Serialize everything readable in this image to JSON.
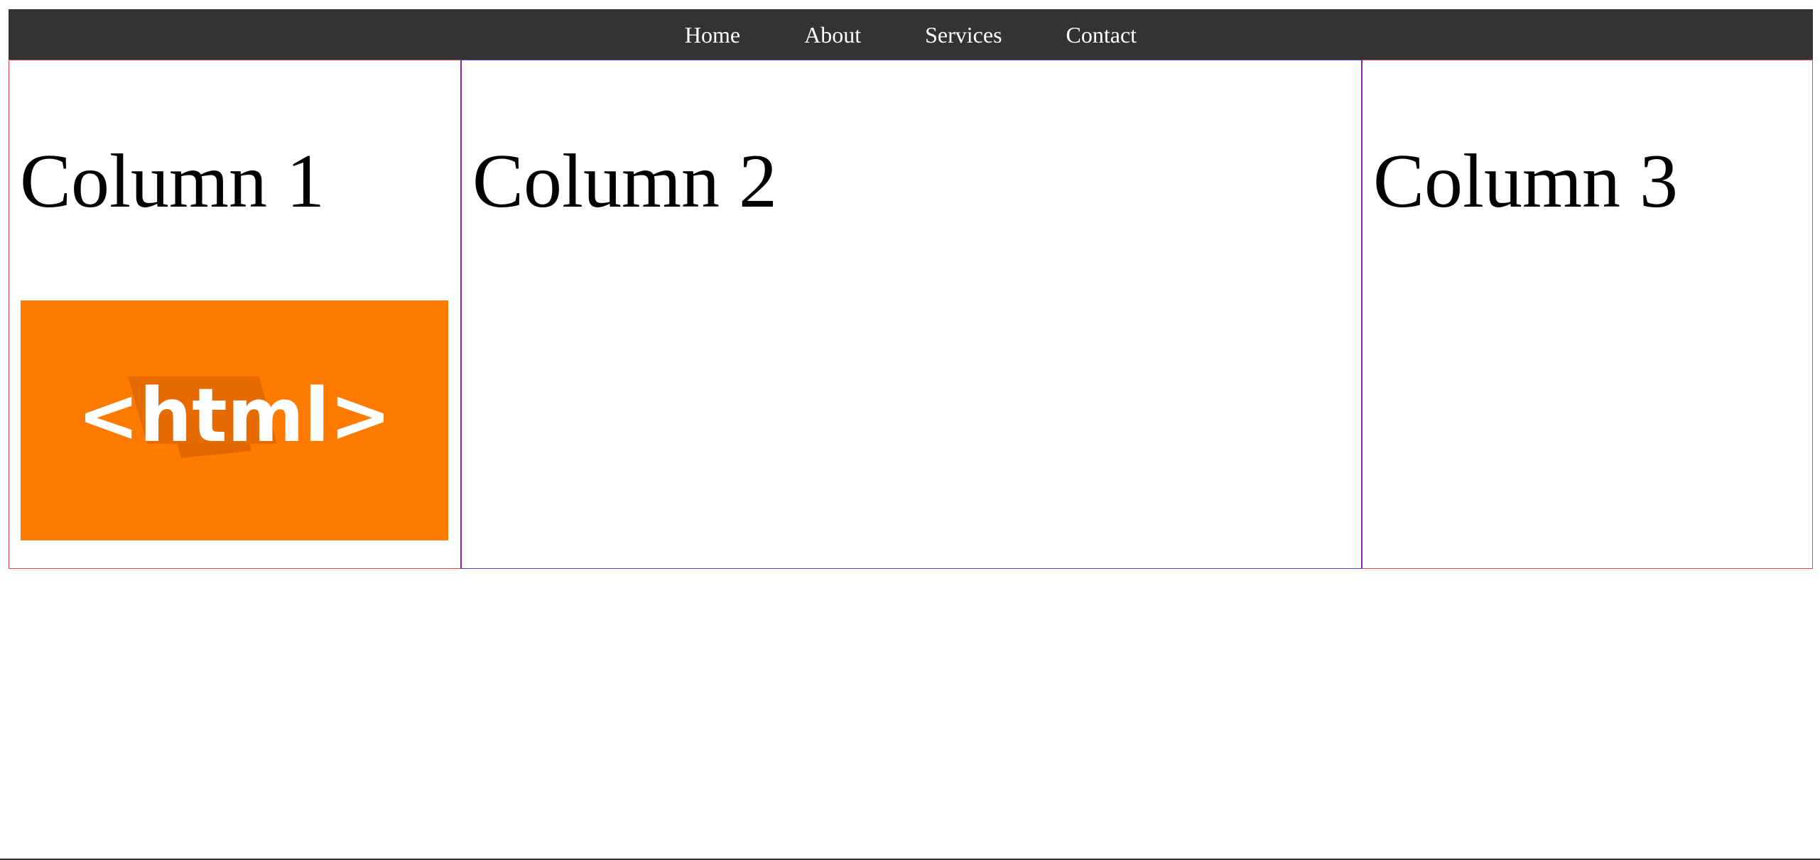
{
  "nav": {
    "items": [
      {
        "label": "Home"
      },
      {
        "label": "About"
      },
      {
        "label": "Services"
      },
      {
        "label": "Contact"
      }
    ]
  },
  "columns": [
    {
      "title": "Column 1",
      "image": {
        "logo_text": "<html>",
        "background": "#ff7b00"
      }
    },
    {
      "title": "Column 2"
    },
    {
      "title": "Column 3"
    }
  ],
  "colors": {
    "navbar_bg": "#333333",
    "nav_text": "#ffffff",
    "column_border_outer": "#e34848",
    "column_border_middle": "#5145d7",
    "column_divider": "#8b1fa0",
    "logo_bg": "#ff7b00"
  }
}
